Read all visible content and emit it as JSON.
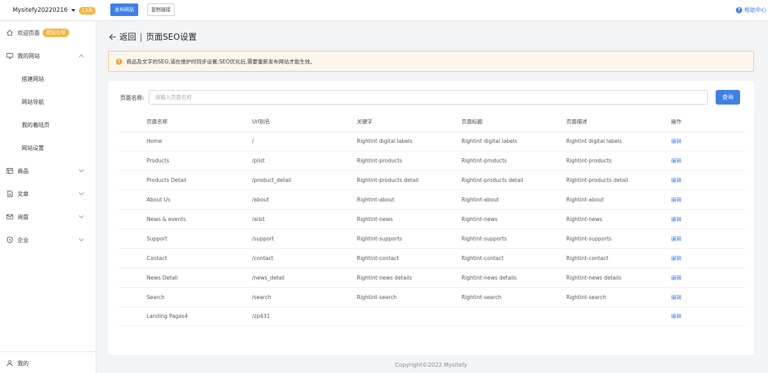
{
  "topbar": {
    "site_name": "Mysitefy20220216",
    "days_badge": "13天",
    "publish_label": "发布网站",
    "copy_link_label": "复制链接",
    "help_label": "帮助中心"
  },
  "sidebar": {
    "welcome": {
      "label": "欢迎页面",
      "badge": "建站引导"
    },
    "my_site": {
      "label": "我的网站"
    },
    "sub_items": [
      "搭建网站",
      "网站导航",
      "我的着陆页",
      "网站设置"
    ],
    "products": {
      "label": "商品"
    },
    "articles": {
      "label": "文章"
    },
    "inquiries": {
      "label": "询盘"
    },
    "company": {
      "label": "企业"
    },
    "mine": {
      "label": "我的"
    }
  },
  "page": {
    "back_label": "返回",
    "separator": "|",
    "title": "页面SEO设置",
    "notice": "商品及文字的SEO,请在维护时同步设置;SEO优化后,需要重新发布网站才能生效。"
  },
  "search": {
    "label": "页面名称:",
    "placeholder": "请输入页面名称",
    "value": "",
    "button": "查询"
  },
  "table": {
    "headers": [
      "页面名称",
      "Url别名",
      "关键字",
      "页面标题",
      "页面描述",
      "操作"
    ],
    "action_label": "编辑",
    "rows": [
      [
        "Home",
        "/",
        "Rightint digital labels",
        "Rightint digital labels",
        "Rightint digital labels"
      ],
      [
        "Products",
        "/plist",
        "Rightint-products",
        "Rightint-products",
        "Rightint-products"
      ],
      [
        "Products Detail",
        "/product_detail",
        "Rightint-products detail",
        "Rightint-products detail",
        "Rightint-products detail"
      ],
      [
        "About Us",
        "/about",
        "Rightint-about",
        "Rightint-about",
        "Rightint-about"
      ],
      [
        "News & events",
        "/alist",
        "Rightint-news",
        "Rightint-news",
        "Rightint-news"
      ],
      [
        "Support",
        "/support",
        "Rightint-supports",
        "Rightint-supports",
        "Rightint-supports"
      ],
      [
        "Contact",
        "/contact",
        "Rightint-contact",
        "Rightint-contact",
        "Rightint-contact"
      ],
      [
        "News Detail",
        "/news_detail",
        "Rightint-news details",
        "Rightint-news details",
        "Rightint-news details"
      ],
      [
        "Search",
        "/search",
        "Rightint-search",
        "Rightint-search",
        "Rightint-search"
      ],
      [
        "Landing Pages4",
        "/zp431",
        "",
        "",
        ""
      ]
    ]
  },
  "footer": {
    "copyright": "Copyright©2022 Mysitefy"
  },
  "colors": {
    "accent": "#3f7fe8",
    "badge": "#f5b43c",
    "notice_bg": "#fdf6ec",
    "notice_border": "#f5c983"
  }
}
